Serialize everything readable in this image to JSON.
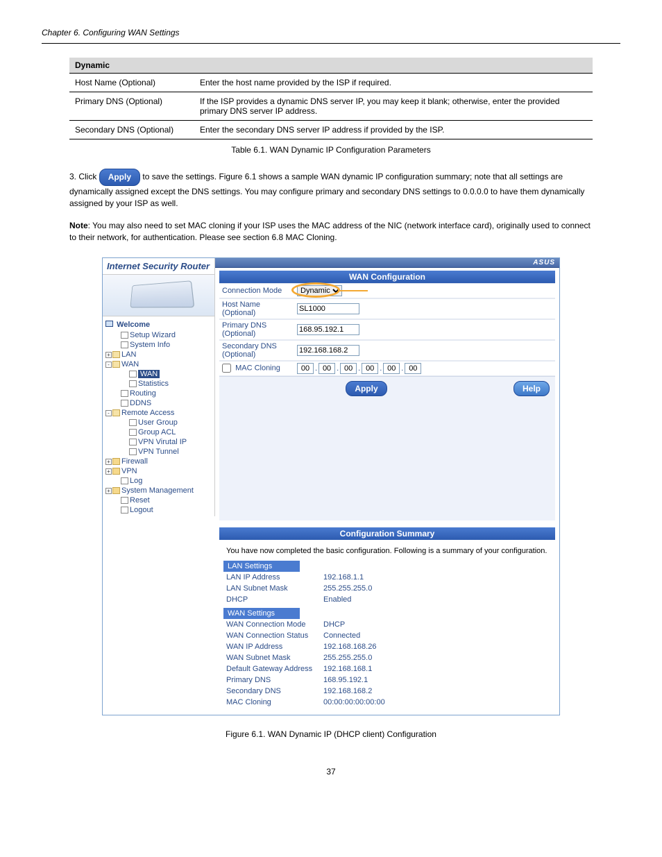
{
  "chapter_header": "Chapter 6. Configuring WAN Settings",
  "params_table": {
    "section_label": "Dynamic",
    "rows": [
      {
        "field": "Host Name (Optional)",
        "desc": "Enter the host name provided by the ISP if required."
      },
      {
        "field": "Primary DNS (Optional)",
        "desc": "If the ISP provides a dynamic DNS server IP, you may keep it blank; otherwise, enter the provided primary DNS server IP address."
      },
      {
        "field": "Secondary DNS (Optional)",
        "desc": "Enter the secondary DNS server IP address if provided by the ISP."
      }
    ]
  },
  "table_caption": "Table 6.1. WAN Dynamic IP Configuration Parameters",
  "paragraph_1": "3. Click",
  "apply_text": "Apply",
  "paragraph_2": " to save the settings. Figure 6.1 shows a sample WAN dynamic IP configuration summary; note that all settings are dynamically assigned except the DNS settings. You may configure primary and secondary DNS settings to 0.0.0.0 to have them dynamically assigned by your ISP as well.",
  "note_label": "Note",
  "note_text": "You may also need to set MAC cloning if your ISP uses the MAC address of the NIC (network interface card), originally used to connect to their network, for authentication. Please see section ‎6.8 MAC Cloning.",
  "screenshot": {
    "left_title": "Internet Security Router",
    "welcome": "Welcome",
    "tree": [
      {
        "lvl": 2,
        "type": "doc",
        "label": "Setup Wizard"
      },
      {
        "lvl": 2,
        "type": "doc",
        "label": "System Info"
      },
      {
        "lvl": 1,
        "type": "fold-open",
        "plus": "+",
        "label": "LAN"
      },
      {
        "lvl": 1,
        "type": "fold-open",
        "plus": "-",
        "label": "WAN"
      },
      {
        "lvl": 3,
        "type": "doc",
        "selected": true,
        "label": "WAN"
      },
      {
        "lvl": 3,
        "type": "doc",
        "label": "Statistics"
      },
      {
        "lvl": 2,
        "type": "doc",
        "label": "Routing"
      },
      {
        "lvl": 2,
        "type": "doc",
        "label": "DDNS"
      },
      {
        "lvl": 1,
        "type": "fold-open",
        "plus": "-",
        "label": "Remote Access"
      },
      {
        "lvl": 3,
        "type": "doc",
        "label": "User Group"
      },
      {
        "lvl": 3,
        "type": "doc",
        "label": "Group ACL"
      },
      {
        "lvl": 3,
        "type": "doc",
        "label": "VPN Virutal IP"
      },
      {
        "lvl": 3,
        "type": "doc",
        "label": "VPN Tunnel"
      },
      {
        "lvl": 1,
        "type": "fold",
        "plus": "+",
        "label": "Firewall"
      },
      {
        "lvl": 1,
        "type": "fold",
        "plus": "+",
        "label": "VPN"
      },
      {
        "lvl": 2,
        "type": "doc",
        "label": "Log"
      },
      {
        "lvl": 1,
        "type": "fold",
        "plus": "+",
        "label": "System Management"
      },
      {
        "lvl": 2,
        "type": "doc",
        "label": "Reset"
      },
      {
        "lvl": 2,
        "type": "doc",
        "label": "Logout"
      }
    ],
    "asus_logo": "ASUS",
    "wan_panel": {
      "title": "WAN Configuration",
      "connection_mode_label": "Connection Mode",
      "connection_mode_value": "Dynamic",
      "host_name_label": "Host Name (Optional)",
      "host_name_value": "SL1000",
      "primary_dns_label": "Primary DNS (Optional)",
      "primary_dns_value": "168.95.192.1",
      "secondary_dns_label": "Secondary DNS (Optional)",
      "secondary_dns_value": "192.168.168.2",
      "mac_cloning_label": "MAC Cloning",
      "mac_values": [
        "00",
        "00",
        "00",
        "00",
        "00",
        "00"
      ],
      "apply_btn": "Apply",
      "help_btn": "Help"
    },
    "summary_panel": {
      "title": "Configuration Summary",
      "note": "You have now completed the basic configuration. Following is a summary of your configuration.",
      "lan_header": "LAN Settings",
      "lan_rows": [
        {
          "k": "LAN IP Address",
          "v": "192.168.1.1"
        },
        {
          "k": "LAN Subnet Mask",
          "v": "255.255.255.0"
        },
        {
          "k": "DHCP",
          "v": "Enabled"
        }
      ],
      "wan_header": "WAN Settings",
      "wan_rows": [
        {
          "k": "WAN Connection Mode",
          "v": "DHCP"
        },
        {
          "k": "WAN Connection Status",
          "v": "Connected"
        },
        {
          "k": "WAN IP Address",
          "v": "192.168.168.26"
        },
        {
          "k": "WAN Subnet Mask",
          "v": "255.255.255.0"
        },
        {
          "k": "Default Gateway Address",
          "v": "192.168.168.1"
        },
        {
          "k": "Primary DNS",
          "v": "168.95.192.1"
        },
        {
          "k": "Secondary DNS",
          "v": "192.168.168.2"
        },
        {
          "k": "MAC Cloning",
          "v": "00:00:00:00:00:00"
        }
      ]
    }
  },
  "figure_caption": "Figure 6.1. WAN Dynamic IP (DHCP client) Configuration",
  "page_number": "37"
}
